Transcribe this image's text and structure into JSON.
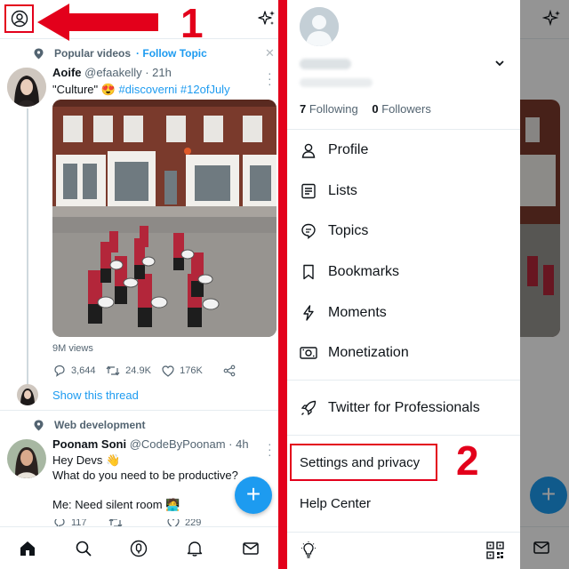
{
  "annotations": {
    "step1": "1",
    "step2": "2"
  },
  "timeline": {
    "tweet1": {
      "context": "Popular videos",
      "context_link": "· Follow Topic",
      "name": "Aoife",
      "handle": "@efaakelly · 21h",
      "text_prefix": "\"Culture\" ",
      "emoji": "😍",
      "hashtags": " #discoverni #12ofJuly",
      "views": "9M views",
      "replies": "3,644",
      "retweets": "24.9K",
      "likes": "176K",
      "show_thread": "Show this thread"
    },
    "tweet2": {
      "context": "Web development",
      "name": "Poonam Soni",
      "handle": "@CodeByPoonam · 4h",
      "line1": "Hey Devs 👋",
      "line2": "What do you need to be productive?",
      "line3": "Me: Need silent room 🧑‍💻",
      "replies": "117",
      "likes": "229"
    },
    "fab": "+"
  },
  "drawer": {
    "following_count": "7",
    "following_label": " Following",
    "followers_count": "0",
    "followers_label": " Followers",
    "menu": [
      {
        "label": "Profile",
        "icon": "person-icon"
      },
      {
        "label": "Lists",
        "icon": "list-icon"
      },
      {
        "label": "Topics",
        "icon": "topic-icon"
      },
      {
        "label": "Bookmarks",
        "icon": "bookmark-icon"
      },
      {
        "label": "Moments",
        "icon": "lightning-icon"
      },
      {
        "label": "Monetization",
        "icon": "money-icon"
      }
    ],
    "professionals": "Twitter for Professionals",
    "settings": "Settings and privacy",
    "help": "Help Center"
  },
  "colors": {
    "accent": "#1d9bf0",
    "annotation": "#e3001b",
    "text": "#0f1419",
    "muted": "#536471"
  }
}
